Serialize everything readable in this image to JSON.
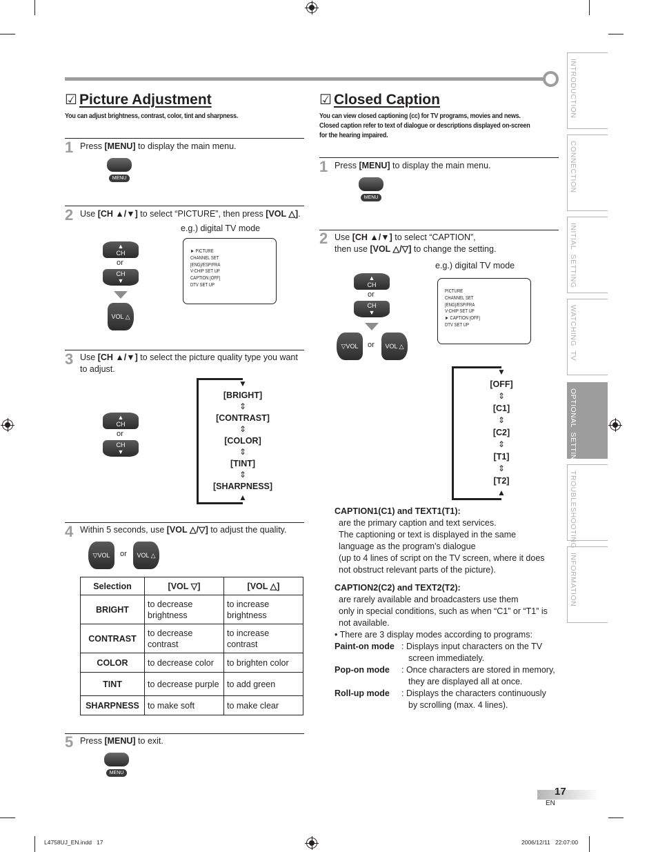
{
  "picture_adjustment": {
    "title": "Picture Adjustment",
    "checkbox_glyph": "☑",
    "lead": "You can adjust brightness, contrast, color, tint and sharpness.",
    "steps": [
      {
        "num": "1",
        "pre": "Press ",
        "key": "[MENU]",
        "post": " to display the main menu.",
        "button_label": "MENU"
      },
      {
        "num": "2",
        "pre": "Use ",
        "key": "[CH ▲/▼]",
        "mid": " to select “PICTURE”, then press ",
        "key2": "[VOL △]",
        "post": "."
      },
      {
        "num": "3",
        "pre": "Use ",
        "key": "[CH ▲/▼]",
        "post": " to select the picture quality type you want to adjust."
      },
      {
        "num": "4",
        "pre": "Within 5 seconds, use ",
        "key": "[VOL △/▽]",
        "post": " to adjust the quality."
      },
      {
        "num": "5",
        "pre": "Press ",
        "key": "[MENU]",
        "post": " to exit.",
        "button_label": "MENU"
      }
    ],
    "osd_caption": "e.g.) digital TV mode",
    "osd_menu": [
      "PICTURE",
      "CHANNEL SET",
      "[ENG]/ESP/FRA",
      "V-CHIP SET UP",
      "CAPTION [OFF]",
      "DTV SET UP"
    ],
    "osd_selected_index": 0,
    "ch_up_label": "CH",
    "ch_down_label": "CH",
    "or_label": "or",
    "vol_up_label": "VOL △",
    "vol_down_label": "▽VOL",
    "cycle": [
      "[BRIGHT]",
      "[CONTRAST]",
      "[COLOR]",
      "[TINT]",
      "[SHARPNESS]"
    ],
    "table": {
      "headers": [
        "Selection",
        "[VOL ▽]",
        "[VOL △]"
      ],
      "rows": [
        [
          "BRIGHT",
          "to decrease brightness",
          "to increase brightness"
        ],
        [
          "CONTRAST",
          "to decrease contrast",
          "to increase contrast"
        ],
        [
          "COLOR",
          "to decrease color",
          "to brighten color"
        ],
        [
          "TINT",
          "to decrease purple",
          "to add green"
        ],
        [
          "SHARPNESS",
          "to make soft",
          "to make clear"
        ]
      ]
    }
  },
  "closed_caption": {
    "title": "Closed Caption",
    "checkbox_glyph": "☑",
    "lead_lines": [
      "You can view closed captioning (cc) for TV programs, movies and news.",
      "Closed caption refer to text of dialogue or descriptions displayed on-screen",
      "for the hearing impaired."
    ],
    "steps": [
      {
        "num": "1",
        "pre": "Press ",
        "key": "[MENU]",
        "post": " to display the main menu.",
        "button_label": "MENU"
      },
      {
        "num": "2",
        "pre": "Use ",
        "key": "[CH ▲/▼]",
        "mid": " to select “CAPTION”,",
        "line2_pre": "then use ",
        "key2": "[VOL △/▽]",
        "post": " to change the setting."
      }
    ],
    "osd_caption": "e.g.) digital TV mode",
    "osd_menu": [
      "PICTURE",
      "CHANNEL SET",
      "[ENG]/ESP/FRA",
      "V-CHIP SET UP",
      "CAPTION [OFF]",
      "DTV SET UP"
    ],
    "osd_selected_index": 4,
    "ch_up_label": "CH",
    "ch_down_label": "CH",
    "or_label": "or",
    "vol_up_label": "VOL △",
    "vol_down_label": "▽VOL",
    "cycle": [
      "[OFF]",
      "[C1]",
      "[C2]",
      "[T1]",
      "[T2]"
    ],
    "notes": {
      "c1_heading": "CAPTION1(C1) and TEXT1(T1):",
      "c1_lines": [
        "are the primary caption and text services.",
        "The captioning or text is displayed in the same",
        "language as the program’s dialogue",
        "(up to 4 lines of script on the TV screen, where it does",
        "not obstruct relevant parts of the picture)."
      ],
      "c2_heading": "CAPTION2(C2) and TEXT2(T2):",
      "c2_lines": [
        "are rarely available and broadcasters use them",
        "only in special conditions, such as when “C1” or “T1” is",
        "not available."
      ],
      "bullet": "• There are 3 display modes according to programs:",
      "modes": [
        {
          "name": "Paint-on mode",
          "desc": ": Displays input characters on the TV screen immediately."
        },
        {
          "name": "Pop-on mode",
          "desc": ": Once characters are stored in memory, they are displayed all at once."
        },
        {
          "name": "Roll-up mode",
          "desc": ": Displays the characters continuously by scrolling (max. 4 lines)."
        }
      ]
    }
  },
  "side_tabs": [
    {
      "label": "INTRODUCTION",
      "active": false
    },
    {
      "label": "CONNECTION",
      "active": false
    },
    {
      "label": "INITIAL  SETTING",
      "active": false
    },
    {
      "label": "WATCHING  TV",
      "active": false
    },
    {
      "label": "OPTIONAL  SETTING",
      "active": true
    },
    {
      "label": "TROUBLESHOOTING",
      "active": false
    },
    {
      "label": "INFORMATION",
      "active": false
    }
  ],
  "footer": {
    "page_number": "17",
    "language": "EN",
    "slug_file": "L4758UJ_EN.indd   17",
    "slug_date": "2006/12/11   22:07:00"
  }
}
